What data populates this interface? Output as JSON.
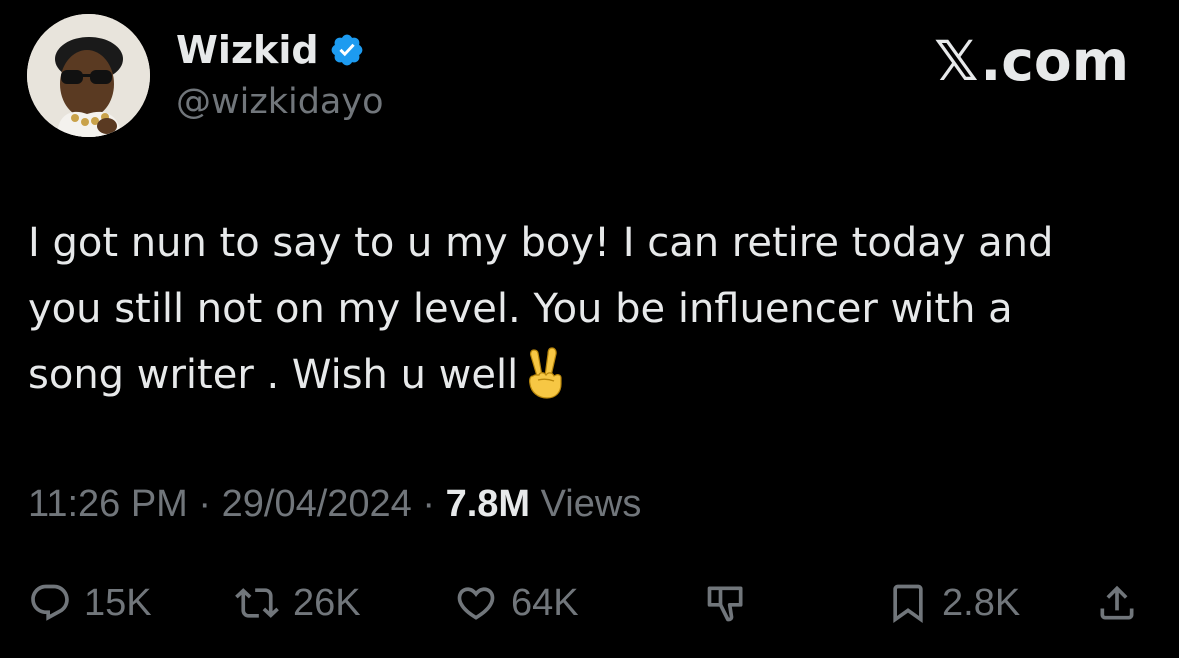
{
  "tweet": {
    "author": {
      "display_name": "Wizkid",
      "handle": "@wizkidayo",
      "verified": true,
      "avatar_icon": "profile-photo"
    },
    "watermark": {
      "x_mark": "𝕏",
      "suffix": ".com"
    },
    "text": "I got nun to say to u my boy! I can retire today and\nyou still not on my level. You be influencer with a\nsong writer . Wish u well",
    "emoji": "✌️",
    "time": "11:26 PM",
    "separator": "·",
    "date": "29/04/2024",
    "views_count": "7.8M",
    "views_label": "Views",
    "stats": {
      "replies": "15K",
      "reposts": "26K",
      "likes": "64K",
      "bookmarks": "2.8K"
    }
  },
  "colors": {
    "background": "#000000",
    "primary_text": "#e7e9ea",
    "secondary_text": "#71767b",
    "verified_blue": "#1d9bf0"
  }
}
